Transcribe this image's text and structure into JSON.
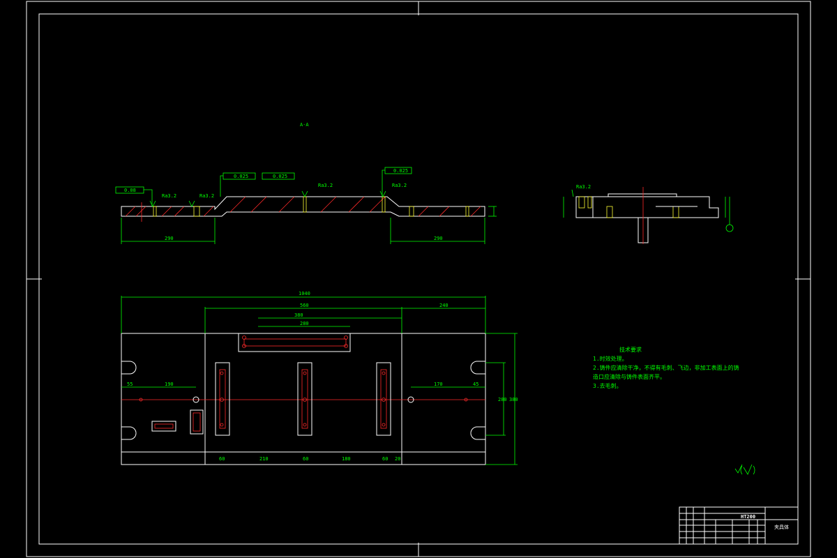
{
  "drawing": {
    "section_label": "A-A",
    "title_block": {
      "material_code": "HT200",
      "part_name": "夹具体"
    },
    "tech_requirements": {
      "heading": "技术要求",
      "items": [
        "1.时效处理。",
        "2.铸件应清除干净，不得有毛刺、飞边，非加工表面上的铸",
        "  造口应清除与铸件表面齐平。",
        "3.去毛刺。"
      ]
    },
    "dimensions": {
      "overall_length": "1040",
      "mid_span": "560",
      "right_span": "240",
      "top_slot_len": "380",
      "top_slot_inner": "280",
      "left_section_len": "290",
      "right_section_len": "290",
      "left_offset": "55",
      "left_hole_dist": "190",
      "right_hole_dist": "170",
      "right_edge": "45",
      "height_total": "380",
      "height_inner": "280",
      "bottom_a": "60",
      "bottom_b": "210",
      "bottom_c": "180",
      "bottom_d": "60",
      "bottom_e": "20"
    },
    "tolerances": {
      "parallel_1": "0.08",
      "parallel_2": "0.025",
      "parallel_3": "0.025",
      "parallel_4": "0.025",
      "roughness_1": "Ra3.2",
      "roughness_2": "Ra3.2",
      "roughness_3": "Ra3.2",
      "roughness_4": "Ra3.2",
      "roughness_5": "Ra3.2"
    }
  }
}
